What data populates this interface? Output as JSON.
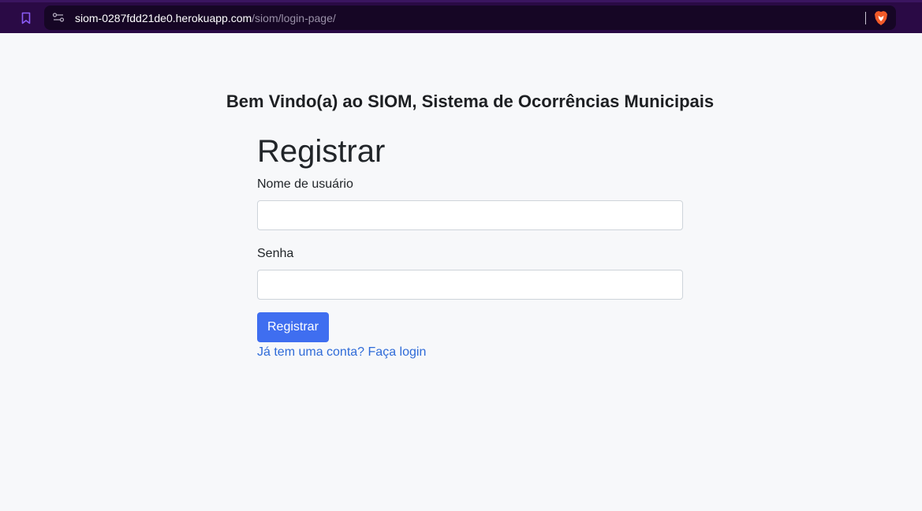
{
  "browser": {
    "url_domain": "siom-0287fdd21de0.herokuapp.com",
    "url_path": "/siom/login-page/",
    "icons": [
      "bookmark-icon",
      "site-info-icon",
      "brave-shield-icon"
    ],
    "accent": "#2a0a45"
  },
  "page": {
    "heading": "Bem Vindo(a) ao SIOM, Sistema de Ocorrências Municipais"
  },
  "form": {
    "title": "Registrar",
    "username_label": "Nome de usuário",
    "username_value": "",
    "password_label": "Senha",
    "password_value": "",
    "submit_label": "Registrar",
    "submit_color": "#3f6ef0",
    "login_link": "Já tem uma conta? Faça login"
  }
}
